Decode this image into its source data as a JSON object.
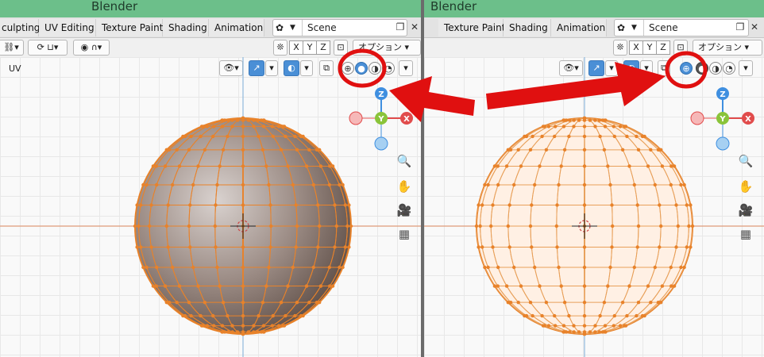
{
  "app_title": "Blender",
  "workspace_tabs": [
    "culpting",
    "UV Editing",
    "Texture Paint",
    "Shading",
    "Animation"
  ],
  "right_workspace_tabs": [
    "Texture Paint",
    "Shading",
    "Animation"
  ],
  "scene_label": "Scene",
  "options_label": "オプション",
  "axis_buttons": [
    "X",
    "Y",
    "Z"
  ],
  "viewport_label": "UV",
  "gizmo_axes": {
    "z": "Z",
    "y": "Y",
    "x": "X"
  },
  "left_view": {
    "shading_mode": "solid",
    "mesh": "uv-sphere",
    "selected_shading_button": "solid-shading-button"
  },
  "right_view": {
    "shading_mode": "wireframe",
    "mesh": "uv-sphere",
    "selected_shading_button": "wireframe-shading-button"
  },
  "colors": {
    "title_bar": "#6cbf8a",
    "accent_blue": "#4a8fd6",
    "highlight_circle": "#e01010",
    "arrow": "#e01010",
    "mesh_vertex": "#e8822a",
    "solid_sphere": "#8f7f78",
    "wire_sphere_fill": "#fff0e4",
    "gizmo_x": "#e14c4c",
    "gizmo_y": "#8ac43a",
    "gizmo_z": "#3f8fe0"
  }
}
